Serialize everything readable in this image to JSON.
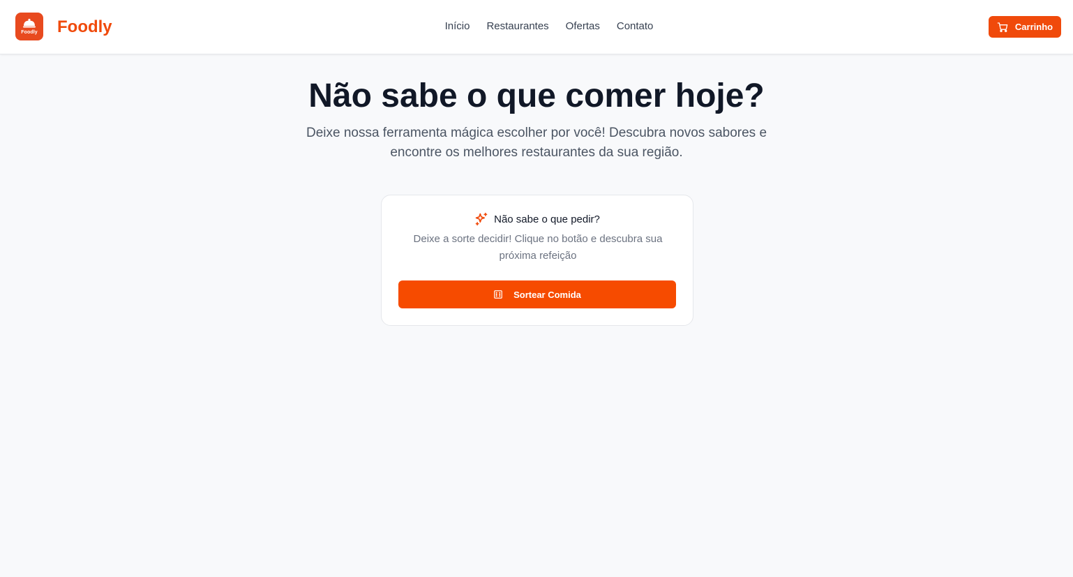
{
  "brand": {
    "name": "Foodly",
    "badge_text": "Foodly",
    "color": "#f04a0b"
  },
  "nav": {
    "items": [
      {
        "label": "Início"
      },
      {
        "label": "Restaurantes"
      },
      {
        "label": "Ofertas"
      },
      {
        "label": "Contato"
      }
    ]
  },
  "header": {
    "cart_label": "Carrinho",
    "cart_icon": "shopping-cart-icon"
  },
  "hero": {
    "title": "Não sabe o que comer hoje?",
    "subtitle": "Deixe nossa ferramenta mágica escolher por você! Descubra novos sabores e encontre os melhores restaurantes da sua região."
  },
  "card": {
    "icon": "sparkles-icon",
    "heading": "Não sabe o que pedir?",
    "description": "Deixe a sorte decidir! Clique no botão e descubra sua próxima refeição",
    "button_label": "Sortear Comida",
    "button_icon": "dice-icon",
    "accent_color": "#f64b00"
  }
}
